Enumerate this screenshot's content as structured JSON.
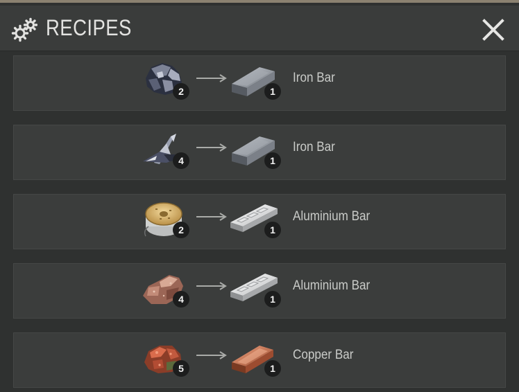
{
  "header": {
    "title": "RECIPES",
    "icon": "gears-icon",
    "close_icon": "close-icon"
  },
  "recipes": [
    {
      "ingredient_icon": "iron-ore-icon",
      "ingredient_qty": "2",
      "product_icon": "iron-bar-icon",
      "product_qty": "1",
      "product_name": "Iron Bar"
    },
    {
      "ingredient_icon": "scrap-metal-icon",
      "ingredient_qty": "4",
      "product_icon": "iron-bar-icon",
      "product_qty": "1",
      "product_name": "Iron Bar"
    },
    {
      "ingredient_icon": "wire-spool-icon",
      "ingredient_qty": "2",
      "product_icon": "aluminium-bar-icon",
      "product_qty": "1",
      "product_name": "Aluminium Bar"
    },
    {
      "ingredient_icon": "bauxite-ore-icon",
      "ingredient_qty": "4",
      "product_icon": "aluminium-bar-icon",
      "product_qty": "1",
      "product_name": "Aluminium Bar"
    },
    {
      "ingredient_icon": "copper-ore-icon",
      "ingredient_qty": "5",
      "product_icon": "copper-bar-icon",
      "product_qty": "1",
      "product_name": "Copper Bar"
    }
  ],
  "colors": {
    "background": "#2f3130",
    "header": "#3a3c3b",
    "row": "#3b3d3c",
    "text": "#c9cbc8",
    "badge": "#1c1d1d"
  }
}
